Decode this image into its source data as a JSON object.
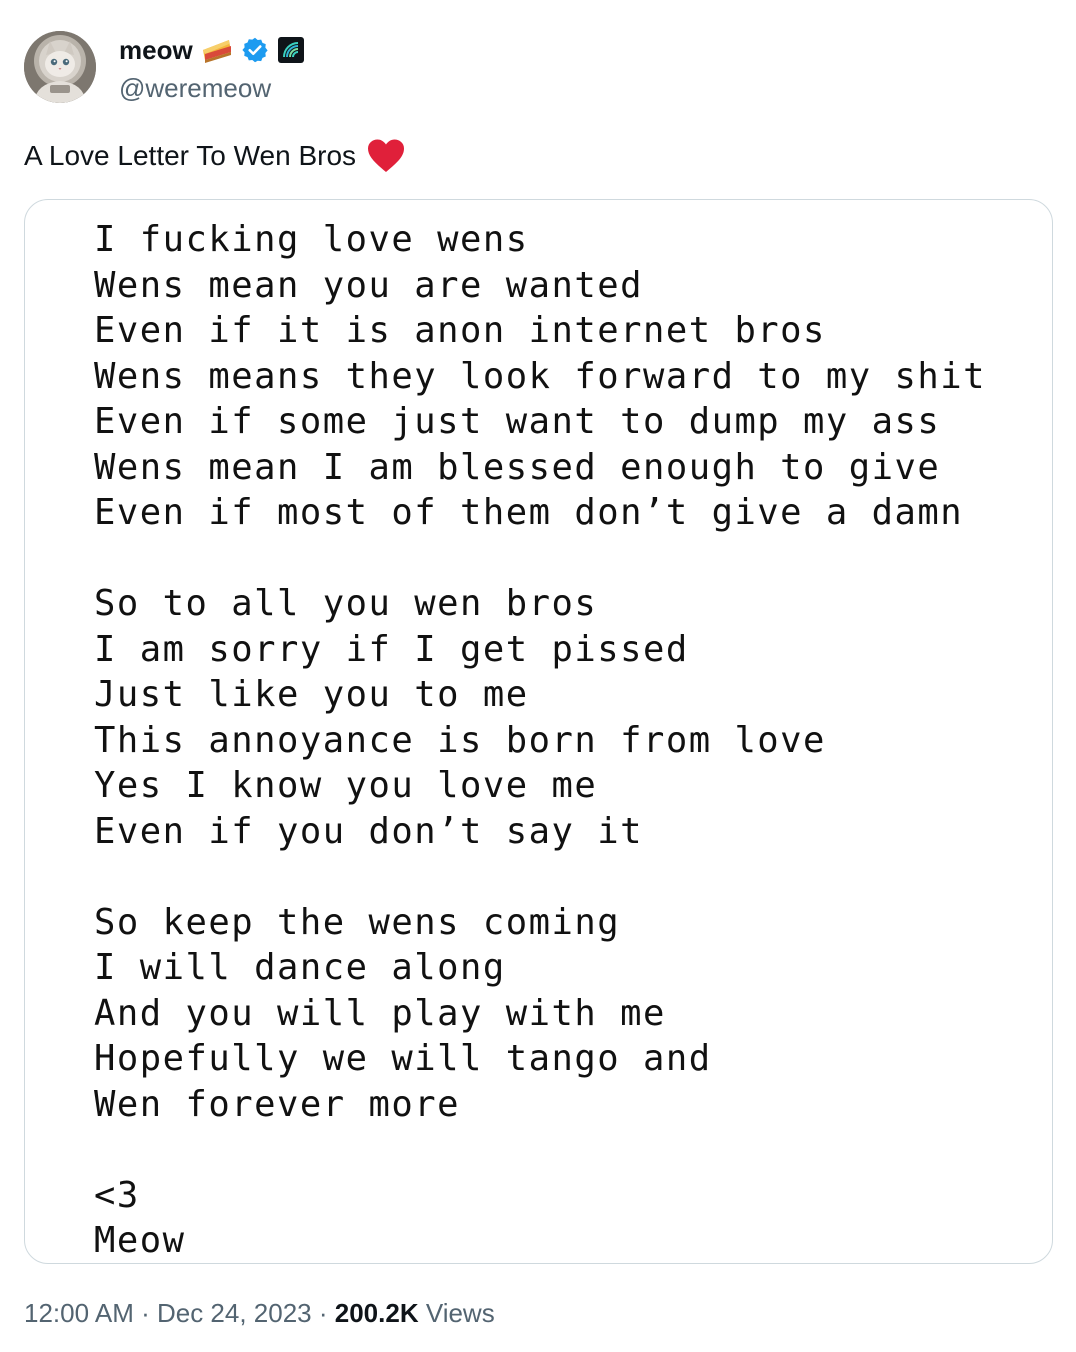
{
  "author": {
    "display_name": "meow",
    "handle": "@weremeow",
    "badge_emoji_icon": "pie-emoji-icon",
    "verified_icon": "verified-badge-icon",
    "affiliate_icon": "affiliate-logo-icon",
    "verified_color": "#1d9bf0"
  },
  "tweet": {
    "text": "A Love Letter To Wen Bros",
    "heart_icon": "red-heart-icon",
    "heart_color": "#e0203a"
  },
  "poem_lines": [
    "I fucking love wens",
    "Wens mean you are wanted",
    "Even if it is anon internet bros",
    "Wens means they look forward to my shit",
    "Even if some just want to dump my ass",
    "Wens mean I am blessed enough to give",
    "Even if most of them don’t give a damn",
    "",
    "So to all you wen bros",
    "I am sorry if I get pissed",
    "Just like you to me",
    "This annoyance is born from love",
    "Yes I know you love me",
    "Even if you don’t say it",
    "",
    "So keep the wens coming",
    "I will dance along",
    "And you will play with me",
    "Hopefully we will tango and",
    "Wen forever more",
    "",
    "<3",
    "Meow"
  ],
  "meta": {
    "time": "12:00 AM",
    "separator": " · ",
    "date": "Dec 24, 2023",
    "views_count": "200.2K",
    "views_label": "Views"
  }
}
